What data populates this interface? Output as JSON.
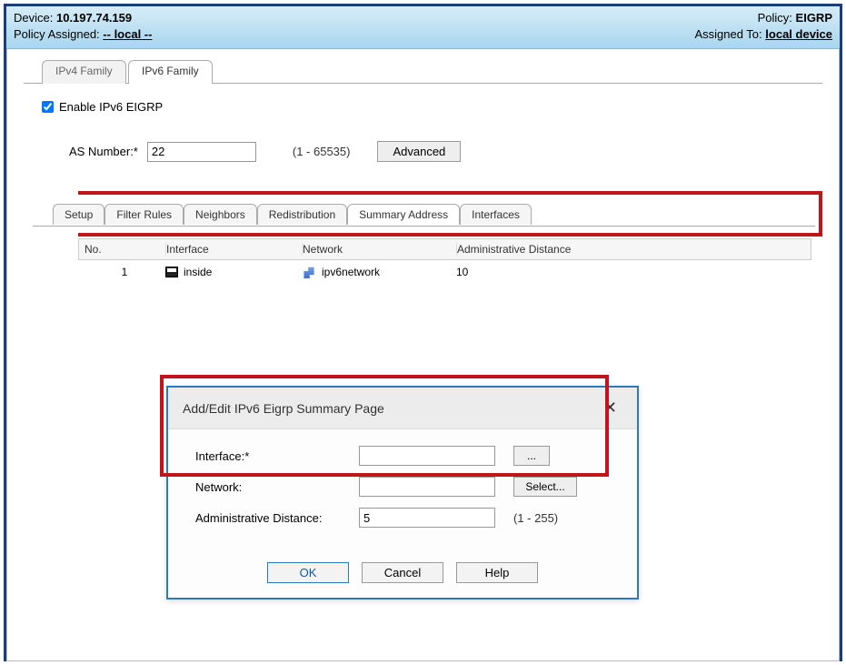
{
  "header": {
    "device_label": "Device:",
    "device_value": "10.197.74.159",
    "policy_assigned_label": "Policy Assigned:",
    "policy_assigned_value": "-- local --",
    "policy_label": "Policy:",
    "policy_value": "EIGRP",
    "assigned_to_label": "Assigned To:",
    "assigned_to_value": "local device"
  },
  "family_tabs": {
    "ipv4": "IPv4 Family",
    "ipv6": "IPv6 Family",
    "active": "ipv6"
  },
  "enable": {
    "label": "Enable IPv6 EIGRP",
    "checked": true
  },
  "as": {
    "label": "AS Number:*",
    "value": "22",
    "hint": "(1 - 65535)",
    "advanced": "Advanced"
  },
  "sub_tabs": [
    "Setup",
    "Filter Rules",
    "Neighbors",
    "Redistribution",
    "Summary Address",
    "Interfaces"
  ],
  "sub_tabs_active": "Summary Address",
  "table": {
    "columns": [
      "No.",
      "Interface",
      "Network",
      "Administrative Distance"
    ],
    "rows": [
      {
        "no": "1",
        "interface": "inside",
        "network": "ipv6network",
        "admin_dist": "10"
      }
    ]
  },
  "dialog": {
    "title": "Add/Edit IPv6 Eigrp Summary Page",
    "close": "✕",
    "fields": {
      "interface_label": "Interface:*",
      "interface_value": "",
      "browse": "...",
      "network_label": "Network:",
      "network_value": "",
      "select": "Select...",
      "admin_label": "Administrative Distance:",
      "admin_value": "5",
      "admin_hint": "(1 - 255)"
    },
    "buttons": {
      "ok": "OK",
      "cancel": "Cancel",
      "help": "Help"
    }
  }
}
